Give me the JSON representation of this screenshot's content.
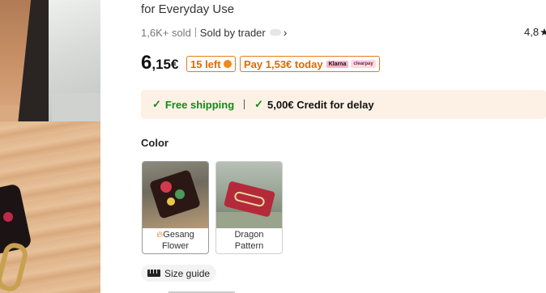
{
  "product": {
    "title_tail": "for Everyday Use",
    "sold_count": "1,6K+ sold",
    "sold_by": "Sold by trader",
    "rating": "4,8",
    "price_int": "6",
    "price_dec": ",15€",
    "stock_badge": "15 left",
    "pay_badge": "Pay 1,53€ today",
    "klarna_label": "Klarna",
    "clearpay_label": "clearpay"
  },
  "shipping": {
    "free": "Free shipping",
    "credit": "5,00€ Credit for delay"
  },
  "color": {
    "label": "Color",
    "options": [
      {
        "line1": "Gesang",
        "line2": "Flower",
        "selected": true
      },
      {
        "line1": "Dragon",
        "line2": "Pattern",
        "selected": false
      }
    ]
  },
  "size_guide": "Size guide",
  "colors": {
    "accent_orange": "#e06a00",
    "success_green": "#108a1a",
    "ship_bar_bg": "#fdf1e6"
  },
  "icons": [
    "check-icon",
    "chevron-right-icon",
    "star-icon",
    "clock-icon",
    "fire-drop-icon",
    "ruler-icon"
  ]
}
